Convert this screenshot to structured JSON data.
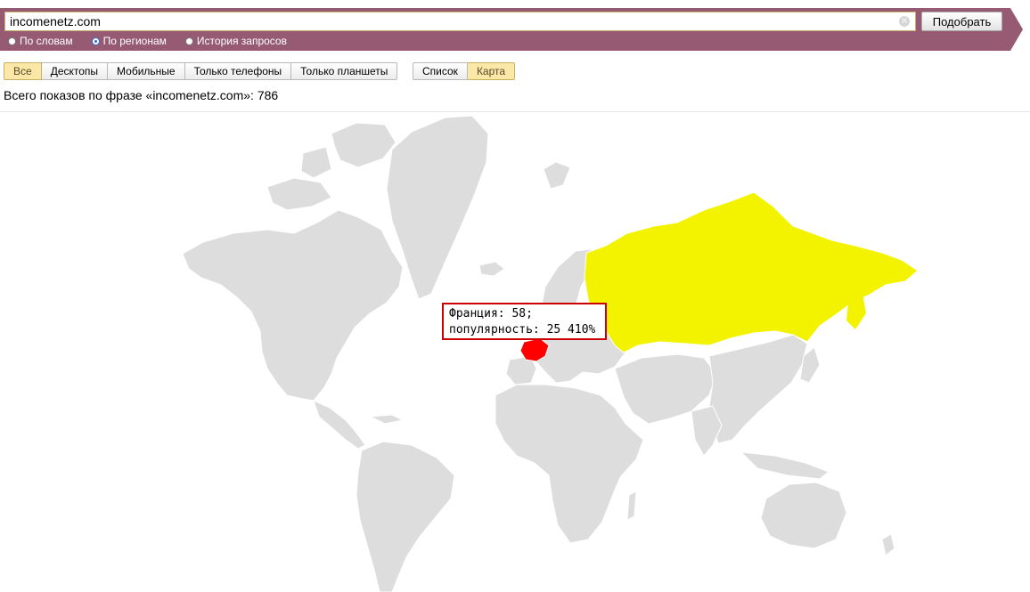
{
  "search": {
    "query": "incomenetz.com",
    "submit_label": "Подобрать",
    "clear_icon": "clear-icon"
  },
  "modes": [
    {
      "label": "По словам",
      "selected": false
    },
    {
      "label": "По регионам",
      "selected": true
    },
    {
      "label": "История запросов",
      "selected": false
    }
  ],
  "device_filters": [
    {
      "label": "Все",
      "active": true
    },
    {
      "label": "Десктопы",
      "active": false
    },
    {
      "label": "Мобильные",
      "active": false
    },
    {
      "label": "Только телефоны",
      "active": false
    },
    {
      "label": "Только планшеты",
      "active": false
    }
  ],
  "view_toggle": [
    {
      "label": "Список",
      "active": false
    },
    {
      "label": "Карта",
      "active": true
    }
  ],
  "summary": {
    "total_text": "Всего показов по фразе «incomenetz.com»: 786"
  },
  "map": {
    "highlighted": [
      {
        "region": "Россия",
        "color": "#f3f300"
      },
      {
        "region": "Франция",
        "color": "#ff0000"
      }
    ],
    "default_land_color": "#dddddd",
    "tooltip": {
      "line1": "Франция: 58;",
      "line2": "популярность: 25 410%"
    }
  },
  "colors": {
    "header_band": "#965b73",
    "active_filter": "#fbe7a6"
  }
}
